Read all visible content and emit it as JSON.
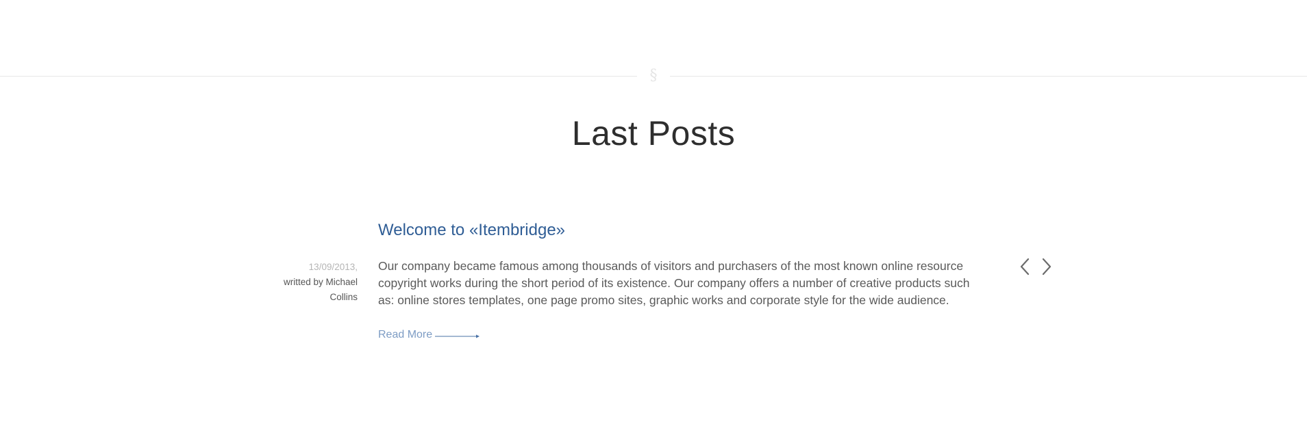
{
  "divider": {
    "symbol": "§"
  },
  "section": {
    "title": "Last Posts"
  },
  "post": {
    "title": "Welcome to «Itembridge»",
    "date": "13/09/2013,",
    "author": "writted by Michael Collins",
    "excerpt": "Our company became famous among thousands of visitors and purchasers of the most known online resource copyright works during the short period of its existence. Our company offers a number of creative products such as: online stores templates, one page promo sites, graphic works and corporate style for the wide audience.",
    "read_more_label": "Read More"
  },
  "navigation": {
    "prev_icon": "chevron-left-icon",
    "next_icon": "chevron-right-icon"
  },
  "colors": {
    "accent": "#2f5d95",
    "link": "#7d9cc4",
    "text": "#5a5a5a",
    "muted": "#b5b5b5",
    "divider": "#e6e6e6"
  }
}
